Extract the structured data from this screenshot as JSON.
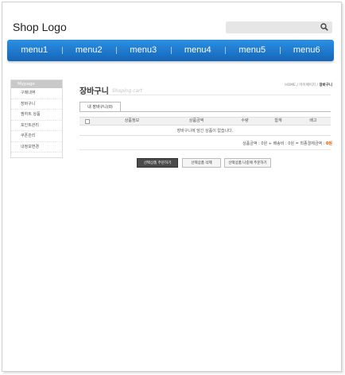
{
  "header": {
    "logo": "Shop Logo",
    "search_icon": "magnifier-icon"
  },
  "nav": {
    "items": [
      "menu1",
      "menu2",
      "menu3",
      "menu4",
      "menu5",
      "menu6"
    ]
  },
  "sidebar": {
    "title": "Mypage",
    "items": [
      "구매내역",
      "장바구니",
      "찜하트 상품",
      "포인트관리",
      "쿠폰관리",
      "내정보변경"
    ]
  },
  "page": {
    "title": "장바구니",
    "subtitle": "Shoping cart",
    "breadcrumb": {
      "home": "HOME",
      "sep1": " / ",
      "mypage": "마이페이지",
      "sep2": " / ",
      "current": "장바구니"
    }
  },
  "cart": {
    "tab_label": "내 장바구니(0)",
    "columns": [
      "상품정보",
      "상품금액",
      "수량",
      "합계",
      "배고"
    ],
    "empty_message": "장바구니에 담긴 상품이 없습니다.",
    "totals": {
      "goods_label": "상품금액 : ",
      "goods_value": "0원",
      "ship_label": " + 배송비 : ",
      "ship_value": "0원",
      "final_label": " = 최종결제금액 : ",
      "final_value": "0원"
    }
  },
  "buttons": {
    "order_selected": "선택상품 주문하기",
    "delete_selected": "선택상품 삭제",
    "order_other": "선택상품 나중에 주문하기"
  },
  "colors": {
    "nav_top": "#2b90e3",
    "nav_bottom": "#1565b8",
    "final_amount": "#e25b00"
  }
}
